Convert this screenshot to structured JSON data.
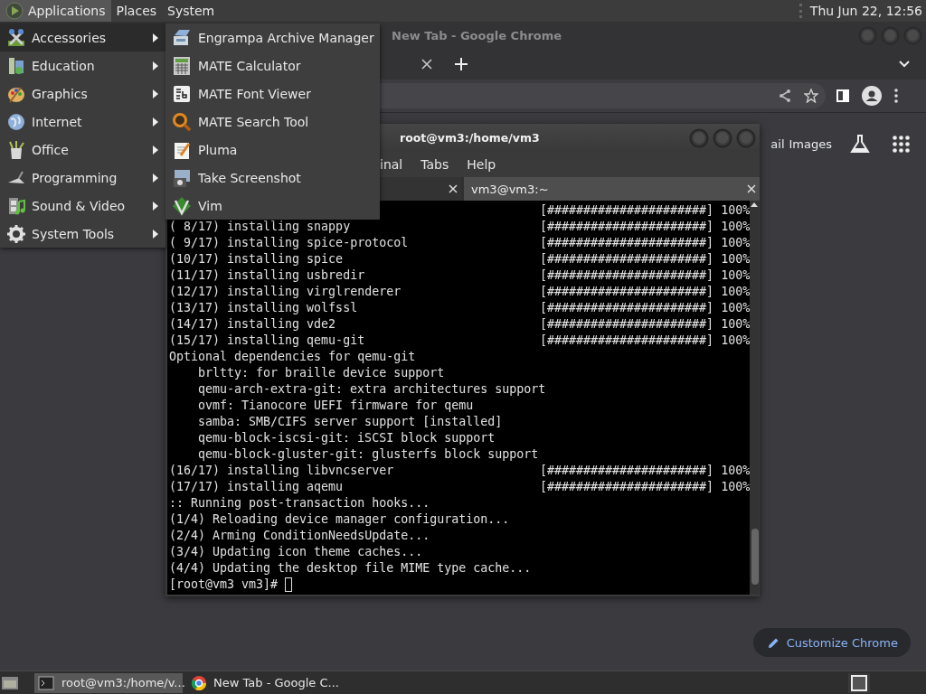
{
  "top_panel": {
    "menus": [
      {
        "label": "Applications",
        "selected": true
      },
      {
        "label": "Places",
        "selected": false
      },
      {
        "label": "System",
        "selected": false
      }
    ],
    "clock": "Thu Jun 22, 12:56"
  },
  "chrome": {
    "title": "New Tab - Google Chrome",
    "page_links": [
      "ail",
      "Images"
    ],
    "customize_button": "Customize Chrome"
  },
  "terminal": {
    "title": "root@vm3:/home/vm3",
    "menus": [
      "inal",
      "Tabs",
      "Help"
    ],
    "tabs": [
      {
        "selected": false
      },
      {
        "label": "vm3@vm3:~",
        "selected": true
      }
    ],
    "lines": [
      {
        "kind": "progress",
        "progress": "[######################] 100%"
      },
      {
        "kind": "progress",
        "text": "( 8/17) installing snappy",
        "progress": "[######################] 100%"
      },
      {
        "kind": "progress",
        "text": "( 9/17) installing spice-protocol",
        "progress": "[######################] 100%"
      },
      {
        "kind": "progress",
        "text": "(10/17) installing spice",
        "progress": "[######################] 100%"
      },
      {
        "kind": "progress",
        "text": "(11/17) installing usbredir",
        "progress": "[######################] 100%"
      },
      {
        "kind": "progress",
        "text": "(12/17) installing virglrenderer",
        "progress": "[######################] 100%"
      },
      {
        "kind": "progress",
        "text": "(13/17) installing wolfssl",
        "progress": "[######################] 100%"
      },
      {
        "kind": "progress",
        "text": "(14/17) installing vde2",
        "progress": "[######################] 100%"
      },
      {
        "kind": "progress",
        "text": "(15/17) installing qemu-git",
        "progress": "[######################] 100%"
      },
      {
        "kind": "plain",
        "text": "Optional dependencies for qemu-git"
      },
      {
        "kind": "dependency",
        "text": "brltty: for braille device support"
      },
      {
        "kind": "dependency",
        "text": "qemu-arch-extra-git: extra architectures support"
      },
      {
        "kind": "dependency",
        "text": "ovmf: Tianocore UEFI firmware for qemu"
      },
      {
        "kind": "dependency",
        "text": "samba: SMB/CIFS server support [installed]"
      },
      {
        "kind": "dependency",
        "text": "qemu-block-iscsi-git: iSCSI block support"
      },
      {
        "kind": "dependency",
        "text": "qemu-block-gluster-git: glusterfs block support"
      },
      {
        "kind": "progress",
        "text": "(16/17) installing libvncserver",
        "progress": "[######################] 100%"
      },
      {
        "kind": "progress",
        "text": "(17/17) installing aqemu",
        "progress": "[######################] 100%"
      },
      {
        "kind": "plain",
        "text": ":: Running post-transaction hooks..."
      },
      {
        "kind": "plain",
        "text": "(1/4) Reloading device manager configuration..."
      },
      {
        "kind": "plain",
        "text": "(2/4) Arming ConditionNeedsUpdate..."
      },
      {
        "kind": "plain",
        "text": "(3/4) Updating icon theme caches..."
      },
      {
        "kind": "plain",
        "text": "(4/4) Updating the desktop file MIME type cache..."
      },
      {
        "kind": "prompt",
        "text": "[root@vm3 vm3]#"
      }
    ]
  },
  "applications_menu": {
    "items": [
      {
        "label": "Accessories",
        "selected": true
      },
      {
        "label": "Education",
        "selected": false
      },
      {
        "label": "Graphics",
        "selected": false
      },
      {
        "label": "Internet",
        "selected": false
      },
      {
        "label": "Office",
        "selected": false
      },
      {
        "label": "Programming",
        "selected": false
      },
      {
        "label": "Sound & Video",
        "selected": false
      },
      {
        "label": "System Tools",
        "selected": false
      }
    ]
  },
  "accessories_submenu": {
    "items": [
      "Engrampa Archive Manager",
      "MATE Calculator",
      "MATE Font Viewer",
      "MATE Search Tool",
      "Pluma",
      "Take Screenshot",
      "Vim"
    ]
  },
  "taskbar": {
    "tasks": [
      {
        "label": "root@vm3:/home/v...",
        "selected": true
      },
      {
        "label": "New Tab - Google C...",
        "selected": false
      }
    ]
  }
}
